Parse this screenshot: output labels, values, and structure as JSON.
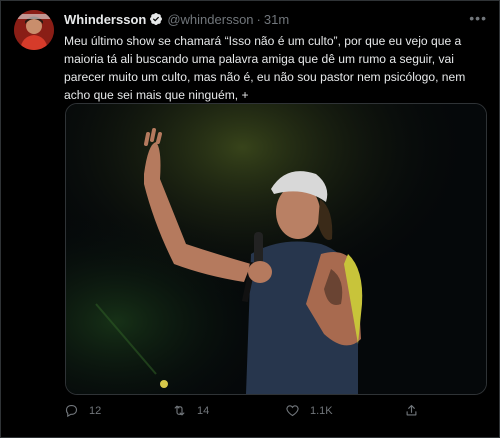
{
  "tweet": {
    "author_name": "Whindersson",
    "handle": "@whindersson",
    "separator": "·",
    "time": "31m",
    "text": "Meu último show se chamará “Isso não é um culto”, por que eu vejo que a maioria tá ali buscando uma palavra amiga que dê um rumo a seguir, vai parecer muito um culto, mas não é, eu não sou pastor nem psicólogo, nem acho que sei mais que ninguém, +",
    "more_icon": "more-icon",
    "verified_icon": "verified-badge-icon"
  },
  "actions": {
    "reply_count": "12",
    "retweet_count": "14",
    "like_count": "1.1K"
  },
  "colors": {
    "background": "#000000",
    "text": "#e7e9ea",
    "muted": "#71767b",
    "verified": "#1d9bf0"
  }
}
